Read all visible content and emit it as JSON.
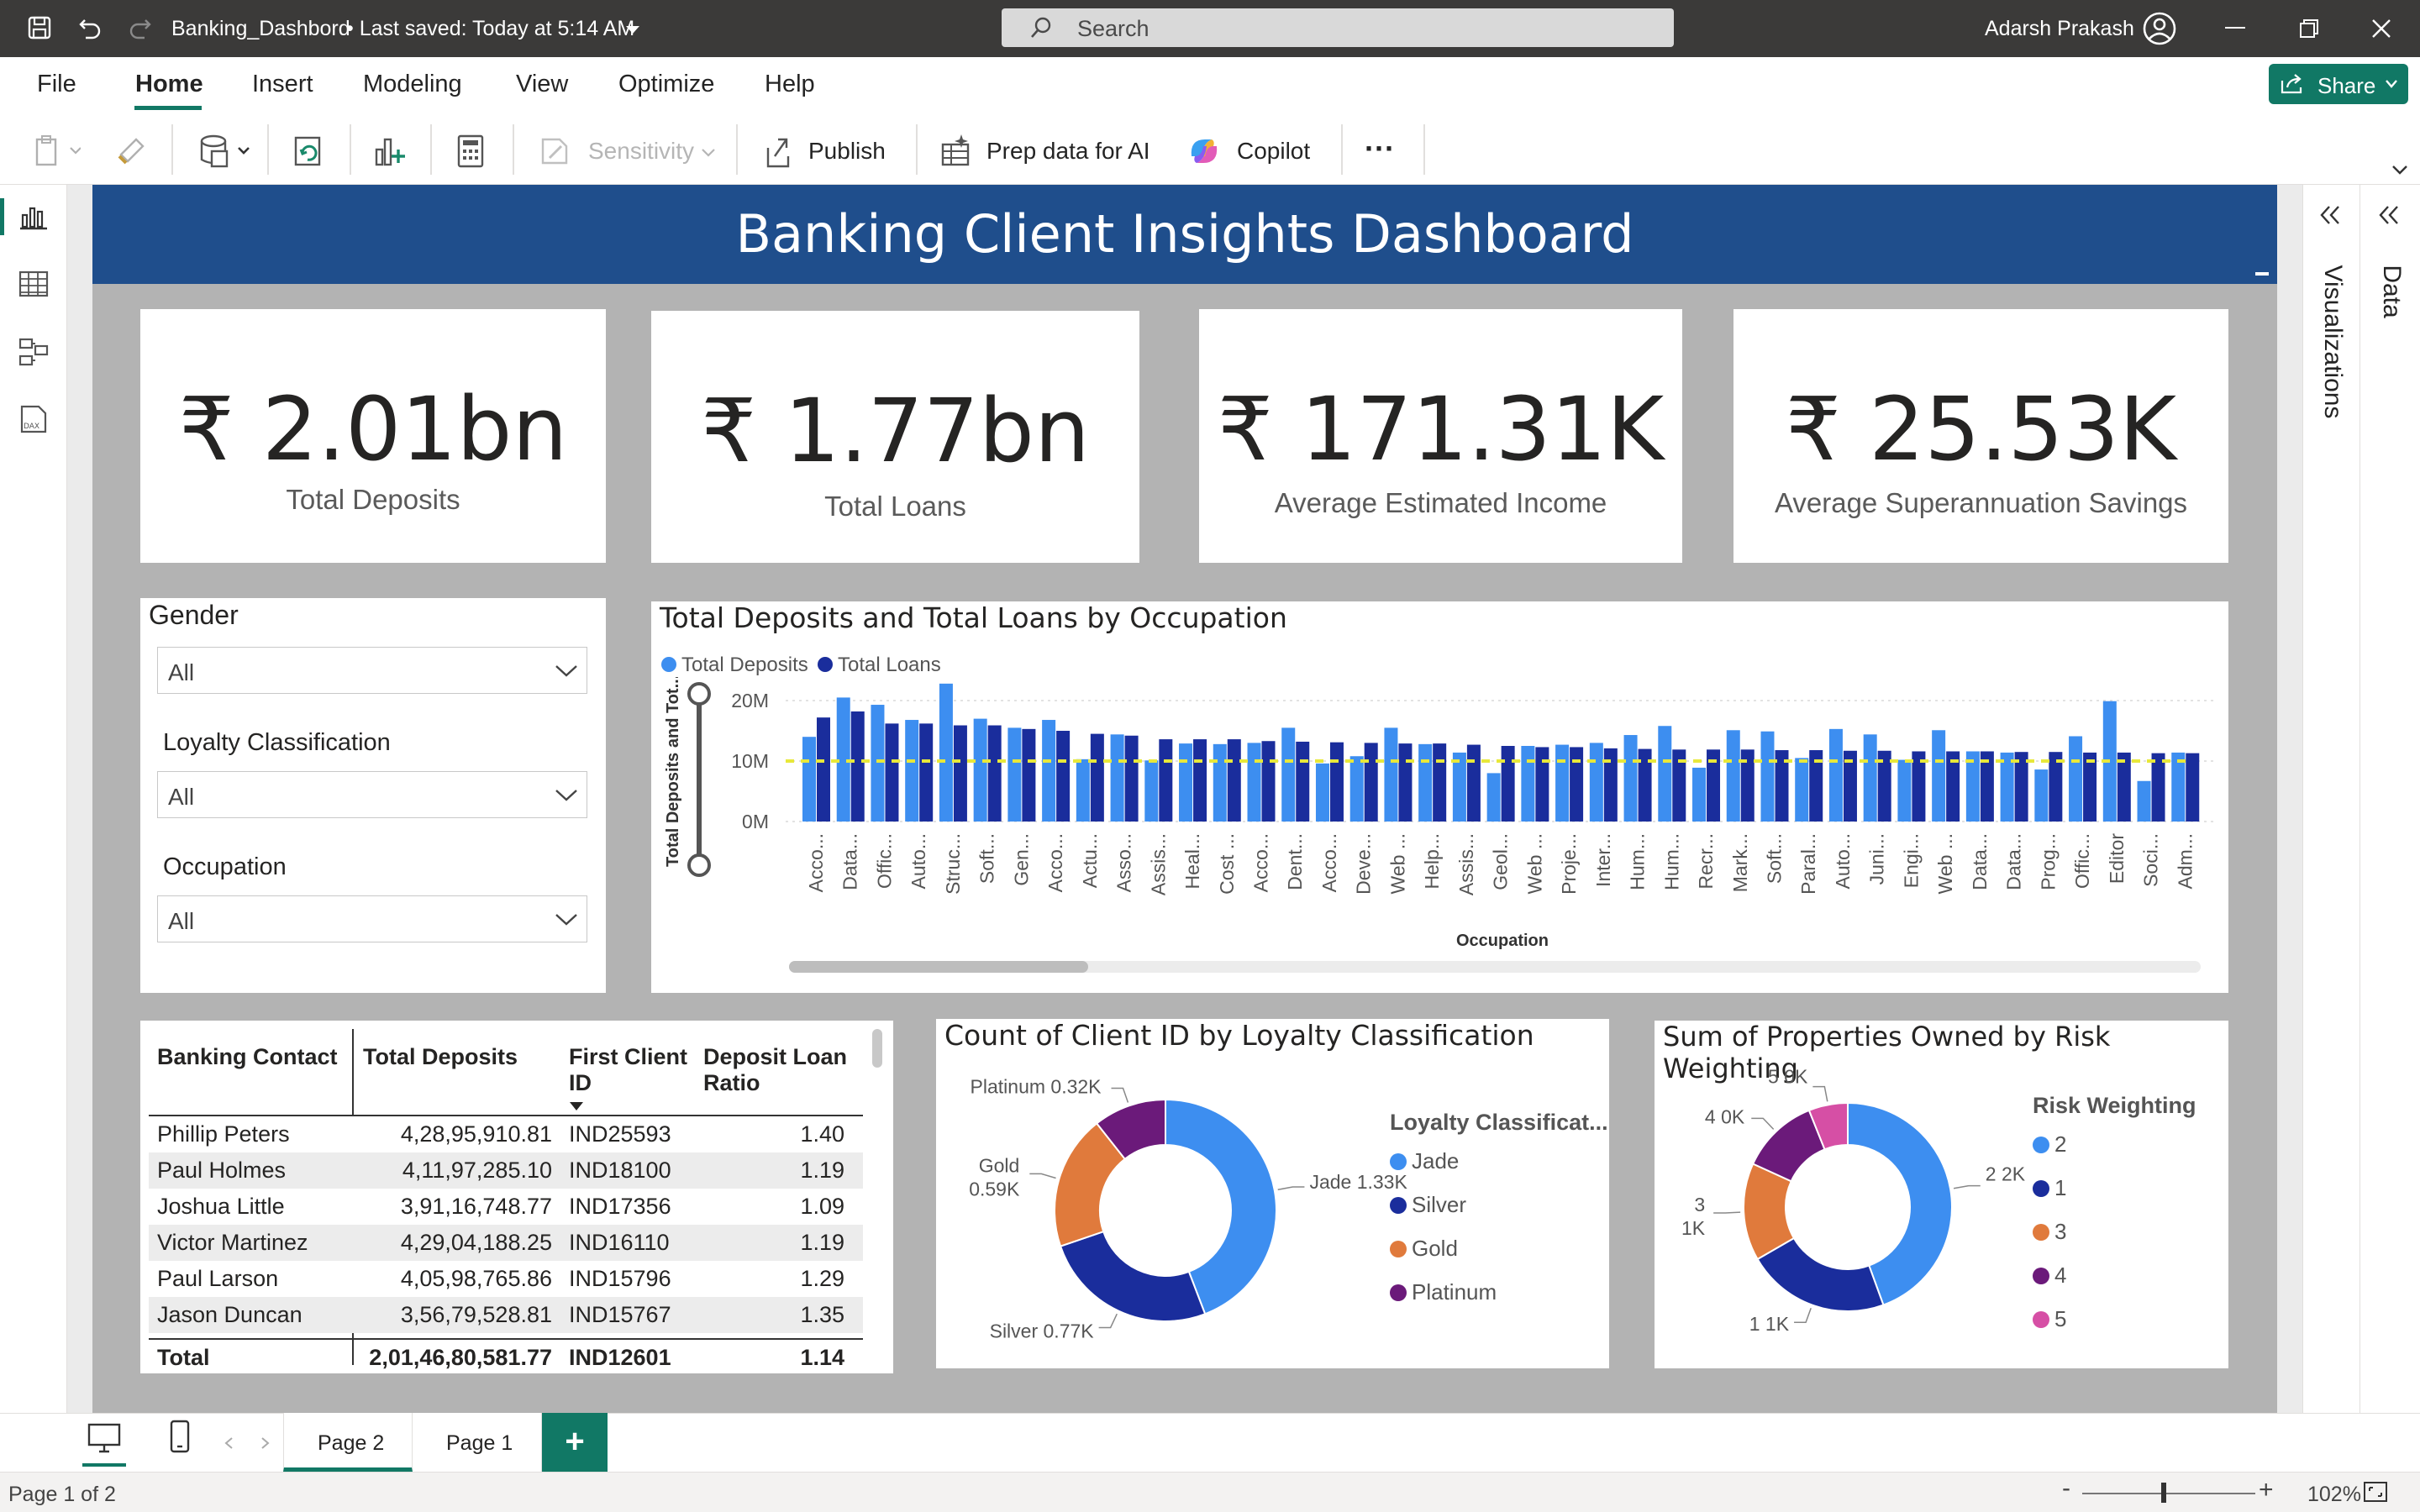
{
  "window": {
    "title": "Banking_Dashbord",
    "saved": "•  Last saved: Today at 5:14 AM",
    "search_placeholder": "Search",
    "user": "Adarsh Prakash"
  },
  "menu": [
    "File",
    "Home",
    "Insert",
    "Modeling",
    "View",
    "Optimize",
    "Help"
  ],
  "share_label": "Share",
  "ribbon": {
    "sensitivity": "Sensitivity",
    "publish": "Publish",
    "prep": "Prep data for AI",
    "copilot": "Copilot",
    "more": "···"
  },
  "report": {
    "title": "Banking Client Insights Dashboard",
    "kpis": [
      {
        "value": "₹ 2.01bn",
        "label": "Total Deposits"
      },
      {
        "value": "₹ 1.77bn",
        "label": "Total Loans"
      },
      {
        "value": "₹ 171.31K",
        "label": "Average Estimated Income"
      },
      {
        "value": "₹ 25.53K",
        "label": "Average Superannuation Savings"
      }
    ],
    "slicers": [
      {
        "title": "Gender",
        "value": "All"
      },
      {
        "title": "Loyalty Classification",
        "value": "All"
      },
      {
        "title": "Occupation",
        "value": "All"
      }
    ]
  },
  "chart_data": [
    {
      "type": "bar",
      "title": "Total Deposits and Total Loans by Occupation",
      "xlabel": "Occupation",
      "ylabel": "Total Deposits and Tot...",
      "yticks": [
        "20M",
        "10M",
        "0M"
      ],
      "ylim": [
        0,
        25
      ],
      "average_line": 10.0,
      "categories": [
        "Acco...",
        "Data...",
        "Offic...",
        "Auto...",
        "Struc...",
        "Soft...",
        "Gen...",
        "Acco...",
        "Actu...",
        "Asso...",
        "Assis...",
        "Heal...",
        "Cost ...",
        "Acco...",
        "Dent...",
        "Acco...",
        "Deve...",
        "Web ...",
        "Help...",
        "Assis...",
        "Geol...",
        "Web ...",
        "Proje...",
        "Inter...",
        "Hum...",
        "Hum...",
        "Recr...",
        "Mark...",
        "Soft...",
        "Paral...",
        "Auto...",
        "Juni...",
        "Engi...",
        "Web ...",
        "Data...",
        "Data...",
        "Prog...",
        "Offic...",
        "Editor",
        "Soci...",
        "Adm..."
      ],
      "series": [
        {
          "name": "Total Deposits",
          "color": "#3d8ef0",
          "values": [
            14,
            20.5,
            19.3,
            16.8,
            22.8,
            17,
            15.5,
            16.8,
            10.3,
            14.4,
            10.1,
            12.9,
            12.8,
            13,
            15.5,
            9.6,
            10.8,
            15.5,
            12.8,
            11.4,
            8,
            12.5,
            12.7,
            13,
            14.3,
            15.8,
            8.9,
            15.1,
            14.9,
            10.5,
            15.3,
            14.4,
            10.2,
            15.1,
            11.6,
            11.4,
            8.6,
            14.1,
            19.9,
            6.7,
            11.4
          ],
          "units": "M"
        },
        {
          "name": "Total Loans",
          "color": "#1a2d9c",
          "values": [
            17.2,
            18.2,
            16.2,
            16.2,
            15.9,
            15.9,
            15.3,
            15,
            14.5,
            14.2,
            13.6,
            13.6,
            13.6,
            13.3,
            13.2,
            13.1,
            13,
            12.9,
            12.9,
            12.7,
            12.5,
            12.3,
            12.3,
            12.1,
            12,
            11.9,
            11.9,
            11.9,
            11.8,
            11.8,
            11.7,
            11.7,
            11.6,
            11.6,
            11.6,
            11.5,
            11.5,
            11.4,
            11.4,
            11.3,
            11.3
          ],
          "units": "M"
        }
      ],
      "legend_position": "top-left"
    },
    {
      "type": "pie",
      "title": "Count of Client ID by Loyalty Classification",
      "legend_title": "Loyalty Classificat...",
      "slices": [
        {
          "name": "Jade",
          "value": 1.33,
          "label": "Jade 1.33K",
          "color": "#3d8ef0"
        },
        {
          "name": "Silver",
          "value": 0.77,
          "label": "Silver 0.77K",
          "color": "#1a2d9c"
        },
        {
          "name": "Gold",
          "value": 0.59,
          "label": "Gold 0.59K",
          "color": "#e07a3c"
        },
        {
          "name": "Platinum",
          "value": 0.32,
          "label": "Platinum 0.32K",
          "color": "#6b1a7a"
        }
      ]
    },
    {
      "type": "pie",
      "title": "Sum of Properties Owned by Risk Weighting",
      "legend_title": "Risk Weighting",
      "slices": [
        {
          "name": "2",
          "value": 2.2,
          "label": "2 2K",
          "color": "#3d8ef0"
        },
        {
          "name": "1",
          "value": 1.1,
          "label": "1 1K",
          "color": "#1a2d9c"
        },
        {
          "name": "3",
          "value": 0.75,
          "label": "3 1K",
          "color": "#e07a3c"
        },
        {
          "name": "4",
          "value": 0.6,
          "label": "4 0K",
          "color": "#6b1a7a"
        },
        {
          "name": "5",
          "value": 0.3,
          "label": "5 0K",
          "color": "#d64fa5"
        }
      ]
    }
  ],
  "table": {
    "headers": [
      "Banking Contact",
      "Total Deposits",
      "First Client ID",
      "Deposit Loan Ratio"
    ],
    "rows": [
      [
        "Phillip Peters",
        "4,28,95,910.81",
        "IND25593",
        "1.40"
      ],
      [
        "Paul Holmes",
        "4,11,97,285.10",
        "IND18100",
        "1.19"
      ],
      [
        "Joshua Little",
        "3,91,16,748.77",
        "IND17356",
        "1.09"
      ],
      [
        "Victor Martinez",
        "4,29,04,188.25",
        "IND16110",
        "1.19"
      ],
      [
        "Paul Larson",
        "4,05,98,765.86",
        "IND15796",
        "1.29"
      ],
      [
        "Jason Duncan",
        "3,56,79,528.81",
        "IND15767",
        "1.35"
      ]
    ],
    "total": [
      "Total",
      "2,01,46,80,581.77",
      "IND12601",
      "1.14"
    ]
  },
  "right_panes": [
    "Visualizations",
    "Data"
  ],
  "pages": [
    "Page 2",
    "Page 1"
  ],
  "status": {
    "page": "Page 1 of 2",
    "zoom": "102%"
  }
}
